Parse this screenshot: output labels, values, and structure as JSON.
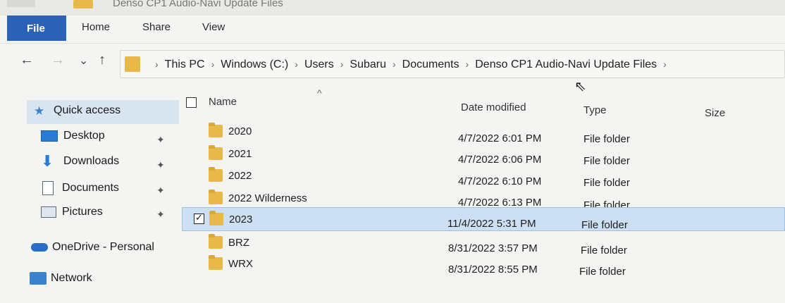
{
  "window": {
    "title": "Denso CP1 Audio-Navi Update Files"
  },
  "ribbon": {
    "tabs": [
      {
        "label": "File"
      },
      {
        "label": "Home"
      },
      {
        "label": "Share"
      },
      {
        "label": "View"
      }
    ]
  },
  "nav": {
    "back_icon": "←",
    "forward_icon": "→",
    "recent_icon": "⌄",
    "up_icon": "↑"
  },
  "breadcrumb": {
    "segments": [
      "This PC",
      "Windows (C:)",
      "Users",
      "Subaru",
      "Documents",
      "Denso CP1 Audio-Navi Update Files"
    ],
    "separator": "›"
  },
  "sidebar": {
    "quick_access": "Quick access",
    "items": [
      {
        "label": "Desktop",
        "icon": "desktop-icon"
      },
      {
        "label": "Downloads",
        "icon": "downloads-icon"
      },
      {
        "label": "Documents",
        "icon": "documents-icon"
      },
      {
        "label": "Pictures",
        "icon": "pictures-icon"
      }
    ],
    "onedrive": "OneDrive - Personal",
    "network": "Network"
  },
  "columns": {
    "name": "Name",
    "date": "Date modified",
    "type": "Type",
    "size": "Size"
  },
  "files": [
    {
      "name": "2020",
      "date": "4/7/2022 6:01 PM",
      "type": "File folder"
    },
    {
      "name": "2021",
      "date": "4/7/2022 6:06 PM",
      "type": "File folder"
    },
    {
      "name": "2022",
      "date": "4/7/2022 6:10 PM",
      "type": "File folder"
    },
    {
      "name": "2022 Wilderness",
      "date": "4/7/2022 6:13 PM",
      "type": "File folder"
    },
    {
      "name": "2023",
      "date": "11/4/2022 5:31 PM",
      "type": "File folder",
      "selected": true
    },
    {
      "name": "BRZ",
      "date": "8/31/2022 3:57 PM",
      "type": "File folder"
    },
    {
      "name": "WRX",
      "date": "8/31/2022 8:55 PM",
      "type": "File folder"
    }
  ],
  "colors": {
    "accent": "#2b62b7",
    "folder": "#e8b94a",
    "selection": "#cde0f3"
  }
}
